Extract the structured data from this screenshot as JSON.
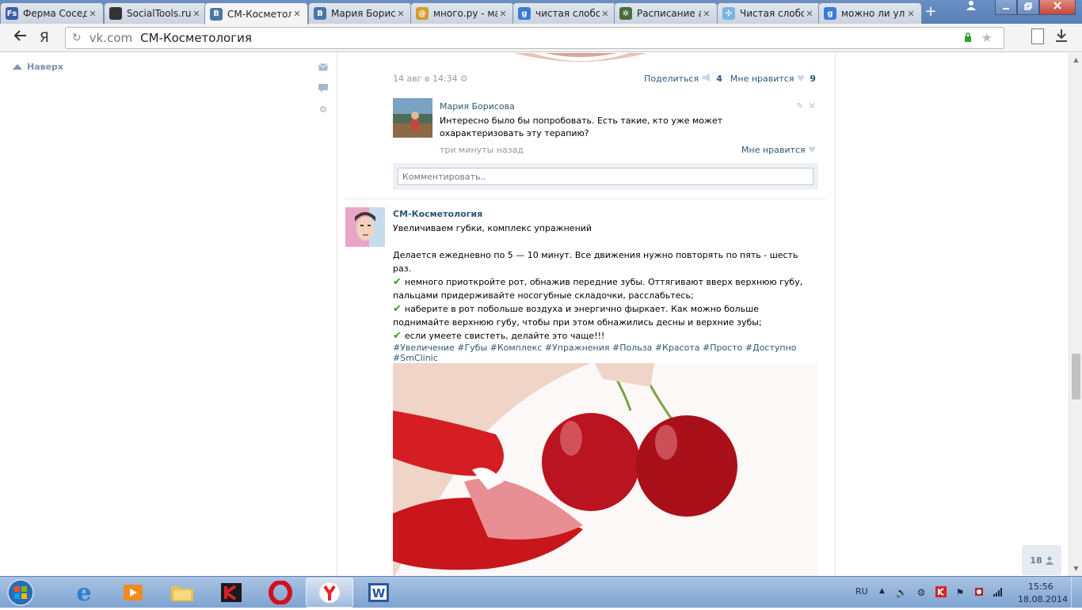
{
  "browser": {
    "tabs": [
      {
        "label": "Ферма Соседи",
        "favicon": "Fs",
        "favicon_color": "#3b5fa8",
        "favicon_text": "Fs"
      },
      {
        "label": "SocialTools.ru",
        "favicon": "circle",
        "favicon_color": "#333333",
        "favicon_text": ""
      },
      {
        "label": "СМ-Косметол",
        "favicon": "vk",
        "favicon_color": "#4a76a8",
        "favicon_text": "B"
      },
      {
        "label": "Мария Борис",
        "favicon": "vk",
        "favicon_color": "#4a76a8",
        "favicon_text": "B"
      },
      {
        "label": "много.ру - ма",
        "favicon": "mnogo",
        "favicon_color": "#d79a2b",
        "favicon_text": "@"
      },
      {
        "label": "чистая слобод",
        "favicon": "google",
        "favicon_color": "#3a7bd5",
        "favicon_text": "g"
      },
      {
        "label": "Расписание ав",
        "favicon": "gear",
        "favicon_color": "#4b6b3a",
        "favicon_text": "✲"
      },
      {
        "label": "Чистая слобод",
        "favicon": "flake",
        "favicon_color": "#7ab4e0",
        "favicon_text": "✣"
      },
      {
        "label": "можно ли улу",
        "favicon": "google",
        "favicon_color": "#3a7bd5",
        "favicon_text": "g"
      }
    ],
    "active_tab_index": 2,
    "new_tab_label": "+",
    "url_domain": "vk.com",
    "url_title": "СМ-Косметология",
    "yandex_label": "Я"
  },
  "sidebar": {
    "up_link": "Наверх"
  },
  "post1": {
    "date": "14 авг в 14:34",
    "share_label": "Поделиться",
    "share_count": "4",
    "like_label": "Мне нравится",
    "like_count": "9"
  },
  "comment": {
    "author": "Мария Борисова",
    "text": "Интересно было бы попробовать. Есть такие, кто уже может охарактеризовать эту терапию?",
    "time": "три минуты назад",
    "like_label": "Мне нравится"
  },
  "comment_input": {
    "placeholder": "Комментировать.."
  },
  "post2": {
    "author": "СМ-Косметология",
    "title": "Увеличиваем губки, комплекс упражнений",
    "intro": "Делается ежедневно по 5 — 10 минут. Все движения нужно повторять по пять - шесть раз.",
    "steps": [
      "немного приоткройте рот, обнажив передние зубы. Оттягивают вверх верхнюю губу, пальцами придерживайте носогубные складочки, расслабьтесь;",
      "наберите в рот побольше воздуха и энергично фыркает. Как можно больше поднимайте верхнюю губу, чтобы при этом обнажились десны и верхние зубы;",
      "если умеете свистеть, делайте это чаще!!!"
    ],
    "tags": "#Увеличение #Губы #Комплекс #Упражнения #Польза #Красота #Просто #Доступно #SmClinic"
  },
  "counter_widget": {
    "count": "18"
  },
  "taskbar": {
    "language": "RU",
    "time": "15:56",
    "date": "18.08.2014"
  }
}
